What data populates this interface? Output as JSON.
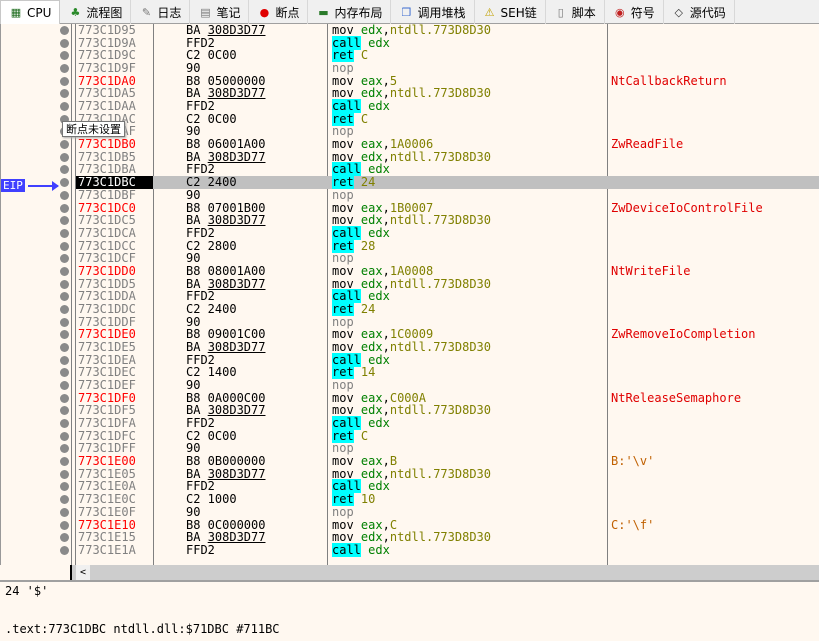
{
  "tabs": [
    {
      "label": "CPU",
      "icon": "cpu-icon",
      "active": true
    },
    {
      "label": "流程图",
      "icon": "tree-icon"
    },
    {
      "label": "日志",
      "icon": "log-icon"
    },
    {
      "label": "笔记",
      "icon": "notes-icon"
    },
    {
      "label": "断点",
      "icon": "breakpoint-icon"
    },
    {
      "label": "内存布局",
      "icon": "memory-icon"
    },
    {
      "label": "调用堆栈",
      "icon": "callstack-icon"
    },
    {
      "label": "SEH链",
      "icon": "seh-icon"
    },
    {
      "label": "脚本",
      "icon": "script-icon"
    },
    {
      "label": "符号",
      "icon": "symbol-icon"
    },
    {
      "label": "源代码",
      "icon": "source-icon"
    }
  ],
  "eip_label": "EIP",
  "tooltip": "断点未设置",
  "selected_address": "773C1DBC",
  "rows": [
    [
      "773C1D95",
      "BA|308D3D77",
      "mov edx,ntdll.773D8D30",
      ""
    ],
    [
      "773C1D9A",
      "FFD2",
      "call edx",
      ""
    ],
    [
      "773C1D9C",
      "C2 0C00",
      "ret C",
      ""
    ],
    [
      "773C1D9F",
      "90",
      "nop",
      ""
    ],
    [
      "773C1DA0",
      "B8 05000000",
      "mov eax,5",
      "NtCallbackReturn"
    ],
    [
      "773C1DA5",
      "BA|308D3D77",
      "mov edx,ntdll.773D8D30",
      ""
    ],
    [
      "773C1DAA",
      "FFD2",
      "call edx",
      ""
    ],
    [
      "773C1DAC",
      "C2 0C00",
      "ret C",
      ""
    ],
    [
      "773C1DAF",
      "90",
      "nop",
      ""
    ],
    [
      "773C1DB0",
      "B8 06001A00",
      "mov eax,1A0006",
      "ZwReadFile"
    ],
    [
      "773C1DB5",
      "BA|308D3D77",
      "mov edx,ntdll.773D8D30",
      ""
    ],
    [
      "773C1DBA",
      "FFD2",
      "call edx",
      ""
    ],
    [
      "773C1DBC",
      "C2 2400",
      "ret 24",
      ""
    ],
    [
      "773C1DBF",
      "90",
      "nop",
      ""
    ],
    [
      "773C1DC0",
      "B8 07001B00",
      "mov eax,1B0007",
      "ZwDeviceIoControlFile"
    ],
    [
      "773C1DC5",
      "BA|308D3D77",
      "mov edx,ntdll.773D8D30",
      ""
    ],
    [
      "773C1DCA",
      "FFD2",
      "call edx",
      ""
    ],
    [
      "773C1DCC",
      "C2 2800",
      "ret 28",
      ""
    ],
    [
      "773C1DCF",
      "90",
      "nop",
      ""
    ],
    [
      "773C1DD0",
      "B8 08001A00",
      "mov eax,1A0008",
      "NtWriteFile"
    ],
    [
      "773C1DD5",
      "BA|308D3D77",
      "mov edx,ntdll.773D8D30",
      ""
    ],
    [
      "773C1DDA",
      "FFD2",
      "call edx",
      ""
    ],
    [
      "773C1DDC",
      "C2 2400",
      "ret 24",
      ""
    ],
    [
      "773C1DDF",
      "90",
      "nop",
      ""
    ],
    [
      "773C1DE0",
      "B8 09001C00",
      "mov eax,1C0009",
      "ZwRemoveIoCompletion"
    ],
    [
      "773C1DE5",
      "BA|308D3D77",
      "mov edx,ntdll.773D8D30",
      ""
    ],
    [
      "773C1DEA",
      "FFD2",
      "call edx",
      ""
    ],
    [
      "773C1DEC",
      "C2 1400",
      "ret 14",
      ""
    ],
    [
      "773C1DEF",
      "90",
      "nop",
      ""
    ],
    [
      "773C1DF0",
      "B8 0A000C00",
      "mov eax,C000A",
      "NtReleaseSemaphore"
    ],
    [
      "773C1DF5",
      "BA|308D3D77",
      "mov edx,ntdll.773D8D30",
      ""
    ],
    [
      "773C1DFA",
      "FFD2",
      "call edx",
      ""
    ],
    [
      "773C1DFC",
      "C2 0C00",
      "ret C",
      ""
    ],
    [
      "773C1DFF",
      "90",
      "nop",
      ""
    ],
    [
      "773C1E00",
      "B8 0B000000",
      "mov eax,B",
      "B:'\\v'"
    ],
    [
      "773C1E05",
      "BA|308D3D77",
      "mov edx,ntdll.773D8D30",
      ""
    ],
    [
      "773C1E0A",
      "FFD2",
      "call edx",
      ""
    ],
    [
      "773C1E0C",
      "C2 1000",
      "ret 10",
      ""
    ],
    [
      "773C1E0F",
      "90",
      "nop",
      ""
    ],
    [
      "773C1E10",
      "B8 0C000000",
      "mov eax,C",
      "C:'\\f'"
    ],
    [
      "773C1E15",
      "BA|308D3D77",
      "mov edx,ntdll.773D8D30",
      ""
    ],
    [
      "773C1E1A",
      "FFD2",
      "call edx",
      ""
    ]
  ],
  "info": {
    "line1": "24 '$'",
    "line2": ".text:773C1DBC ntdll.dll:$71DBC #711BC"
  },
  "colors": {
    "accent_eip": "#4040ff",
    "call_ret_highlight": "#00ffff",
    "register": "#008000",
    "number": "#808000",
    "comment": "#e00000",
    "address_label": "#ff0000"
  }
}
